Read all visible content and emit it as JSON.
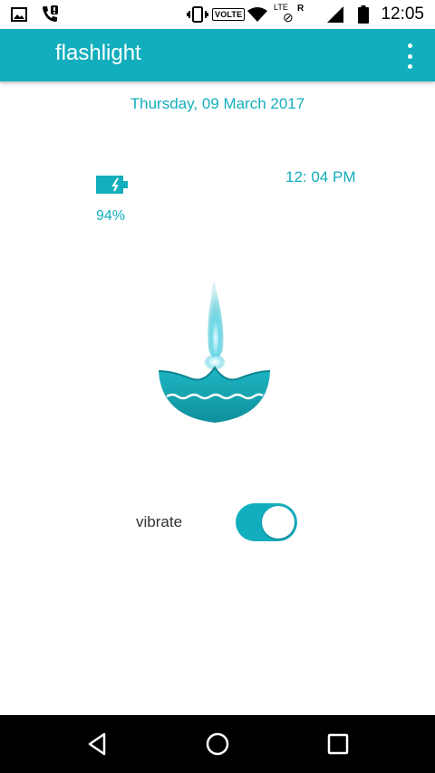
{
  "status_bar": {
    "time": "12:05",
    "volte": "VOLTE",
    "network": "LTE",
    "roaming": "R",
    "icons": [
      "gallery-icon",
      "missed-call-icon",
      "vibrate-icon",
      "volte-icon",
      "wifi-icon",
      "data-icon",
      "signal-icon",
      "battery-icon"
    ]
  },
  "app_bar": {
    "title": "flashlight",
    "menu_icon": "overflow-menu-icon"
  },
  "main": {
    "date": "Thursday, 09 March 2017",
    "battery_percent": "94%",
    "time": "12: 04 PM",
    "vibrate_label": "vibrate",
    "vibrate_on": true,
    "accent_color": "#13aebd"
  },
  "nav_bar": {
    "icons": [
      "back-icon",
      "home-icon",
      "recents-icon"
    ]
  }
}
